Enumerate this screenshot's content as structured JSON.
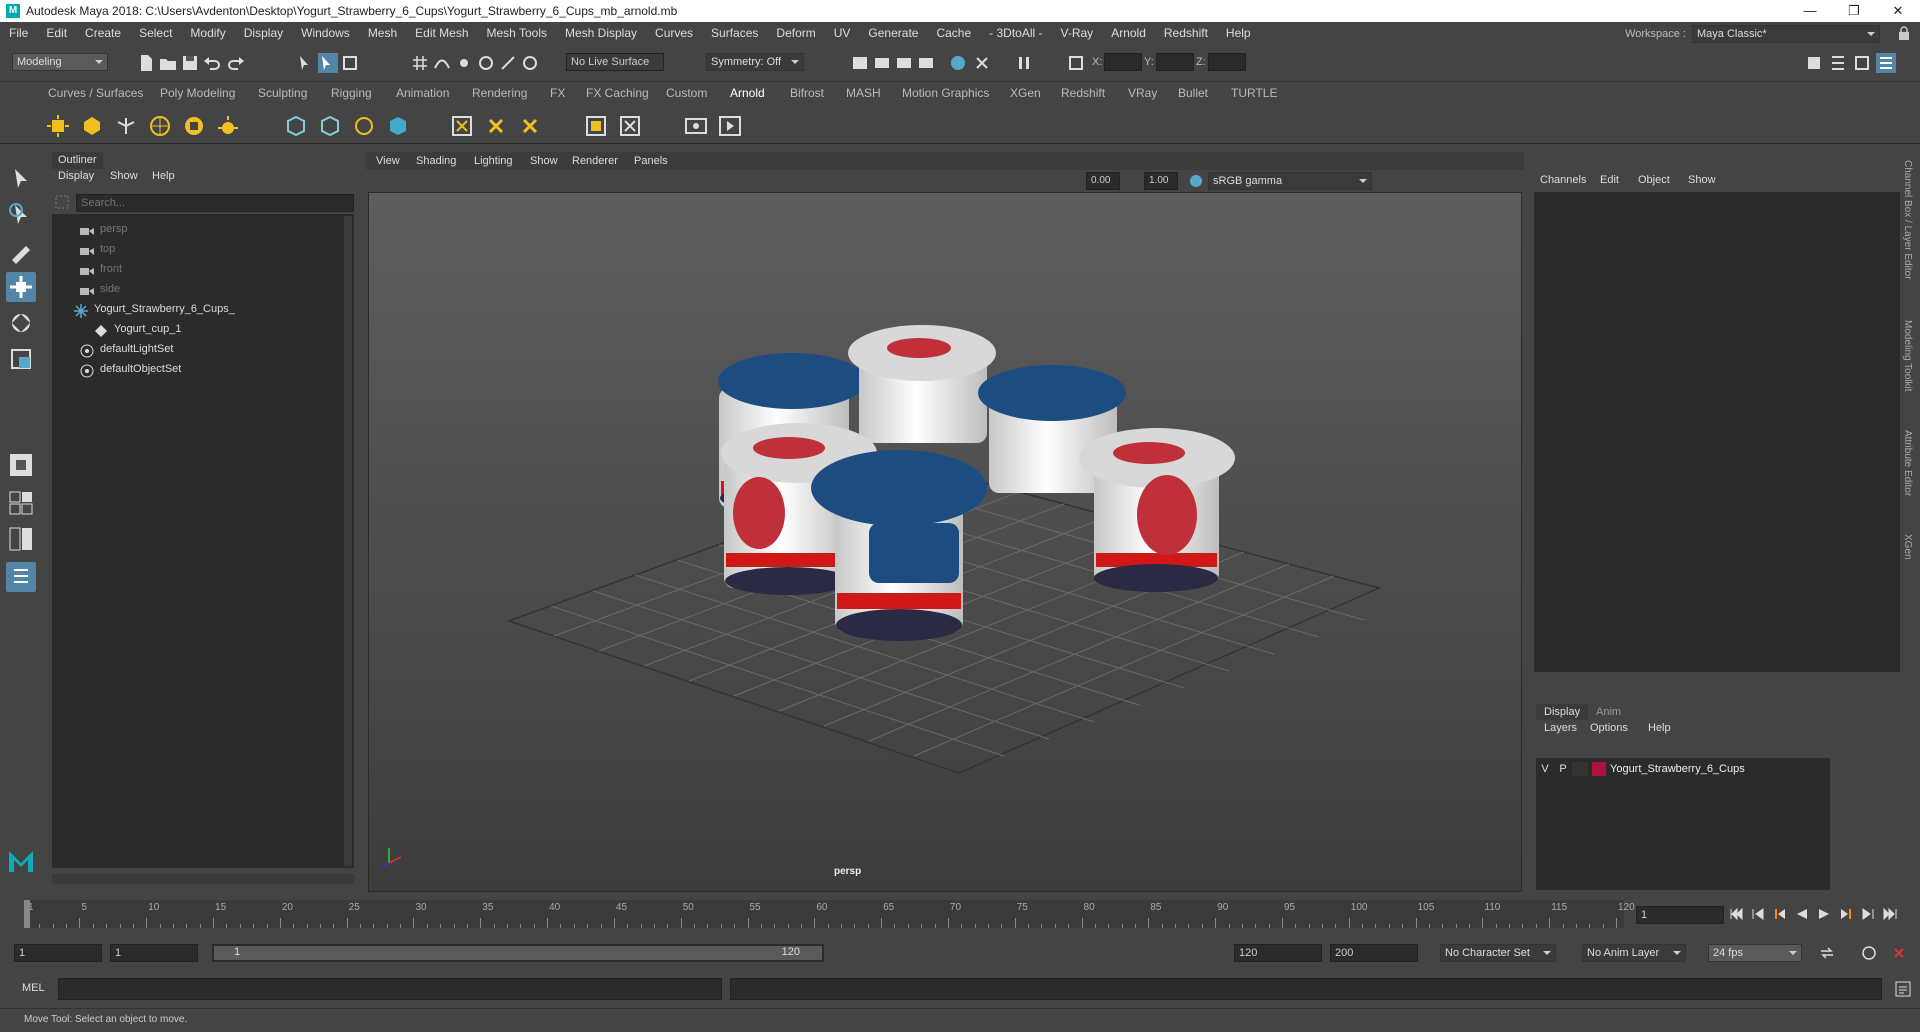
{
  "window": {
    "title": "Autodesk Maya 2018: C:\\Users\\Avdenton\\Desktop\\Yogurt_Strawberry_6_Cups\\Yogurt_Strawberry_6_Cups_mb_arnold.mb",
    "minimize": "—",
    "maximize": "❐",
    "close": "✕"
  },
  "menubar": {
    "items": [
      "File",
      "Edit",
      "Create",
      "Select",
      "Modify",
      "Display",
      "Windows",
      "Mesh",
      "Edit Mesh",
      "Mesh Tools",
      "Mesh Display",
      "Curves",
      "Surfaces",
      "Deform",
      "UV",
      "Generate",
      "Cache",
      "- 3DtoAll -",
      "V-Ray",
      "Arnold",
      "Redshift",
      "Help"
    ],
    "workspace_label": "Workspace :",
    "workspace_value": "Maya Classic*"
  },
  "status": {
    "mode": "Modeling",
    "live_surface": "No Live Surface",
    "symmetry": "Symmetry: Off",
    "x_label": "X:",
    "y_label": "Y:",
    "z_label": "Z:"
  },
  "shelf": {
    "tabs": [
      "Curves / Surfaces",
      "Poly Modeling",
      "Sculpting",
      "Rigging",
      "Animation",
      "Rendering",
      "FX",
      "FX Caching",
      "Custom",
      "Arnold",
      "Bifrost",
      "MASH",
      "Motion Graphics",
      "XGen",
      "Redshift",
      "VRay",
      "Bullet",
      "TURTLE"
    ],
    "active": "Arnold"
  },
  "outliner": {
    "title": "Outliner",
    "menu": [
      "Display",
      "Show",
      "Help"
    ],
    "search_placeholder": "Search...",
    "nodes": [
      {
        "label": "persp",
        "type": "camera",
        "dim": true
      },
      {
        "label": "top",
        "type": "camera",
        "dim": true
      },
      {
        "label": "front",
        "type": "camera",
        "dim": true
      },
      {
        "label": "side",
        "type": "camera",
        "dim": true
      },
      {
        "label": "Yogurt_Strawberry_6_Cups_",
        "type": "group",
        "dim": false
      },
      {
        "label": "Yogurt_cup_1",
        "type": "mesh",
        "dim": false
      },
      {
        "label": "defaultLightSet",
        "type": "set",
        "dim": false
      },
      {
        "label": "defaultObjectSet",
        "type": "set",
        "dim": false
      }
    ]
  },
  "viewport": {
    "menu": [
      "View",
      "Shading",
      "Lighting",
      "Show",
      "Renderer",
      "Panels"
    ],
    "exposure": "0.00",
    "gamma": "1.00",
    "colorspace": "sRGB gamma",
    "camera_label": "persp"
  },
  "channelbox": {
    "menu": [
      "Channels",
      "Edit",
      "Object",
      "Show"
    ],
    "vertical_tabs": [
      "Channel Box / Layer Editor",
      "Modeling Toolkit",
      "Attribute Editor",
      "XGen"
    ]
  },
  "layers": {
    "tabs": [
      "Display",
      "Anim"
    ],
    "menu": [
      "Layers",
      "Options",
      "Help"
    ],
    "rows": [
      {
        "v": "V",
        "p": "P",
        "name": "Yogurt_Strawberry_6_Cups",
        "color": "#b0123a"
      }
    ]
  },
  "timeline": {
    "ticks": [
      1,
      5,
      10,
      15,
      20,
      25,
      30,
      35,
      40,
      45,
      50,
      55,
      60,
      65,
      70,
      75,
      80,
      85,
      90,
      95,
      100,
      105,
      110,
      115,
      120
    ],
    "current_frame": "1"
  },
  "range": {
    "start": "1",
    "start2": "1",
    "slider_start": "1",
    "slider_end": "120",
    "end": "120",
    "end2": "200",
    "character_set": "No Character Set",
    "anim_layer": "No Anim Layer",
    "fps": "24 fps"
  },
  "commandline": {
    "label": "MEL"
  },
  "helpline": {
    "text": "Move Tool: Select an object to move."
  }
}
